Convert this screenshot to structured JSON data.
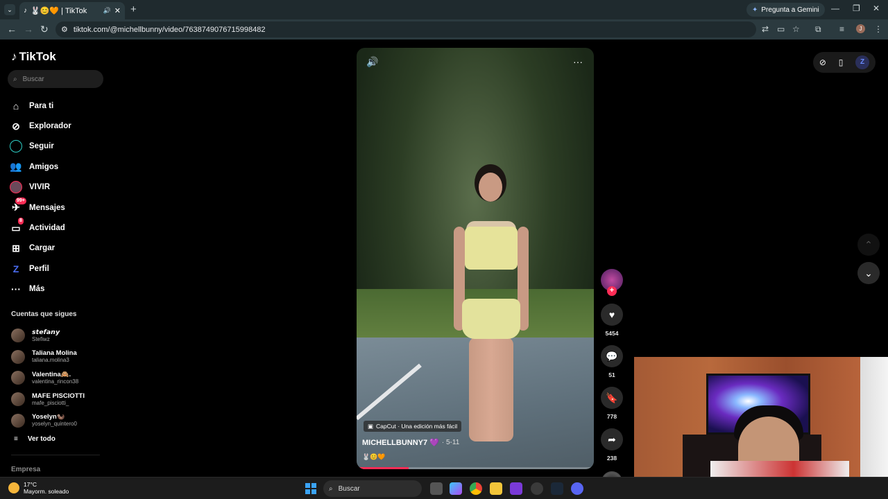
{
  "browser": {
    "tab_title": "🐰😊🧡 | TikTok",
    "gemini_label": "Pregunta a Gemini",
    "url": "tiktok.com/@michellbunny/video/7638749076715998482",
    "profile_initial": "J"
  },
  "sidebar": {
    "logo": "TikTok",
    "search_placeholder": "Buscar",
    "nav": [
      {
        "label": "Para ti",
        "icon": "home-icon"
      },
      {
        "label": "Explorador",
        "icon": "compass-icon"
      },
      {
        "label": "Seguir",
        "icon": "following-icon"
      },
      {
        "label": "Amigos",
        "icon": "friends-icon"
      },
      {
        "label": "VIVIR",
        "icon": "live-icon"
      },
      {
        "label": "Mensajes",
        "icon": "messages-icon",
        "badge": "99+"
      },
      {
        "label": "Actividad",
        "icon": "activity-icon",
        "badge": "8"
      },
      {
        "label": "Cargar",
        "icon": "upload-icon"
      },
      {
        "label": "Perfil",
        "icon": "profile-icon"
      },
      {
        "label": "Más",
        "icon": "more-icon"
      }
    ],
    "following_title": "Cuentas que sigues",
    "following": [
      {
        "name": "𝙨𝙩𝙚𝙛𝙖𝙣𝙮",
        "user": "Stefiwz"
      },
      {
        "name": "Taliana Molina",
        "user": "taliana.molina3"
      },
      {
        "name": "Valentina🙈.",
        "user": "valentina_rincon38"
      },
      {
        "name": "MAFE PISCIOTTI",
        "user": "mafe_pisciotti_"
      },
      {
        "name": "Yoselyn🦦",
        "user": "yoselyn_quintero0"
      }
    ],
    "see_all": "Ver todo",
    "company": "Empresa"
  },
  "video": {
    "capcut": "CapCut · Una edición más fácil",
    "author": "MICHELLBUNNY7 💜",
    "date": "· 5-11",
    "caption": "🐰😊🧡",
    "progress": 0.22
  },
  "actions": {
    "likes": "5454",
    "comments": "51",
    "saves": "778",
    "shares": "238"
  },
  "taskbar": {
    "temp": "17°C",
    "weather": "Mayorm. soleado",
    "search": "Buscar"
  }
}
